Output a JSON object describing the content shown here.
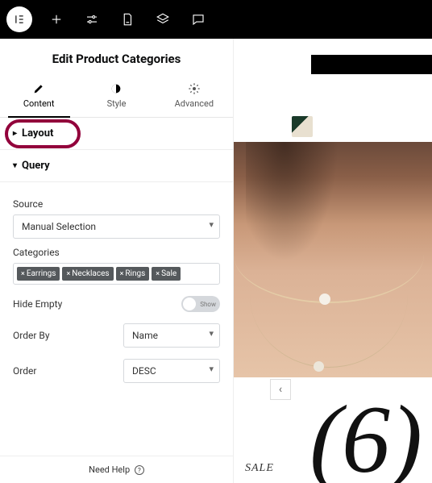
{
  "panel": {
    "title": "Edit Product Categories",
    "tabs": {
      "content": "Content",
      "style": "Style",
      "advanced": "Advanced"
    },
    "sections": {
      "layout": {
        "label": "Layout"
      },
      "query": {
        "label": "Query",
        "source_label": "Source",
        "source_value": "Manual Selection",
        "categories_label": "Categories",
        "tags": [
          "Earrings",
          "Necklaces",
          "Rings",
          "Sale"
        ],
        "hide_empty_label": "Hide Empty",
        "hide_empty_toggle": "Show",
        "order_by_label": "Order By",
        "order_by_value": "Name",
        "order_label": "Order",
        "order_value": "DESC"
      }
    },
    "footer": "Need Help"
  },
  "preview": {
    "sale_text": "SALE",
    "count_display": "(6)",
    "chevron": "‹"
  }
}
